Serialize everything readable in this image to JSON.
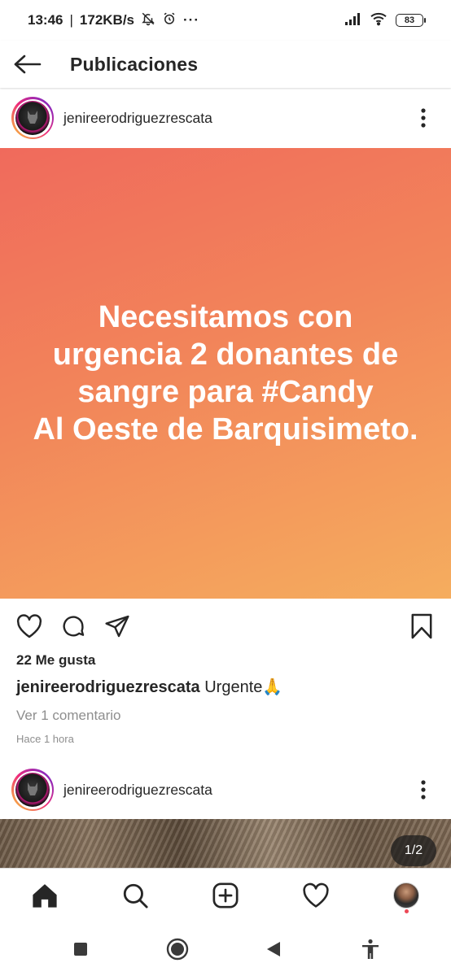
{
  "status_bar": {
    "time": "13:46",
    "speed": "172KB/s",
    "battery": "83",
    "icons": [
      "mute-bell-icon",
      "alarm-icon",
      "more-dots-icon",
      "signal-icon",
      "wifi-icon",
      "battery-icon"
    ]
  },
  "header": {
    "title": "Publicaciones",
    "back_icon": "arrow-left-icon"
  },
  "post1": {
    "username": "jenireerodriguezrescata",
    "image_text": [
      "Necesitamos con",
      "urgencia 2 donantes de",
      "sangre para #Candy",
      "Al Oeste de Barquisimeto."
    ],
    "image_gradient": [
      "#f06a5c",
      "#f5ad5e"
    ],
    "likes": "22 Me gusta",
    "caption_user": "jenireerodriguezrescata",
    "caption_text": "Urgente🙏",
    "view_comments": "Ver 1 comentario",
    "timestamp": "Hace 1 hora",
    "actions": [
      "heart-icon",
      "comment-icon",
      "share-icon",
      "bookmark-icon"
    ]
  },
  "post2": {
    "username": "jenireerodriguezrescata",
    "carousel_counter": "1/2"
  },
  "bottom_nav": {
    "items": [
      "home-icon",
      "search-icon",
      "add-icon",
      "activity-icon",
      "profile-avatar"
    ],
    "active": "home-icon"
  },
  "system_nav": {
    "items": [
      "recents-square-icon",
      "home-circle-icon",
      "back-triangle-icon",
      "accessibility-icon"
    ]
  },
  "colors": {
    "notification_dot": "#ed4956",
    "secondary_text": "#8e8e8e"
  }
}
